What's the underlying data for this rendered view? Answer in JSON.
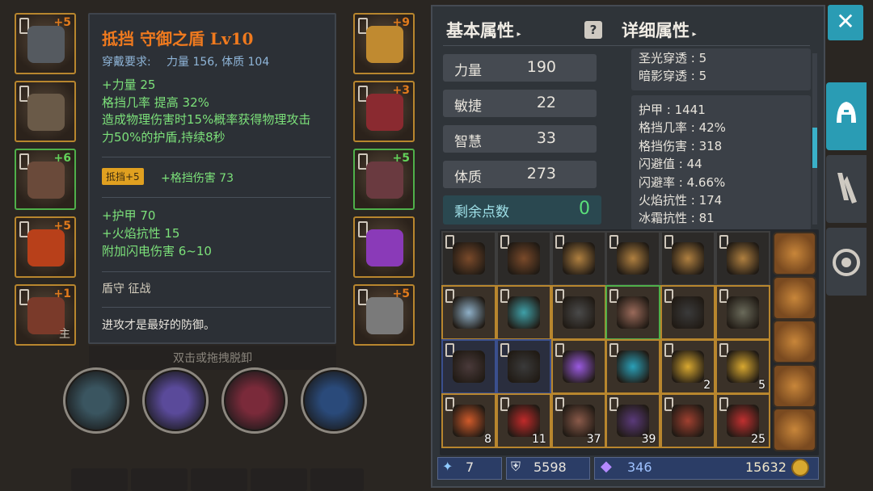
{
  "left_slots": [
    {
      "name": "helmet-slot",
      "plus": "+5",
      "green": false,
      "mark": ""
    },
    {
      "name": "chest-slot",
      "plus": "",
      "green": false,
      "mark": ""
    },
    {
      "name": "legs-slot",
      "plus": "+6",
      "green": true,
      "mark": ""
    },
    {
      "name": "ring-slot",
      "plus": "+5",
      "green": false,
      "mark": ""
    },
    {
      "name": "main-weapon-slot",
      "plus": "+1",
      "green": false,
      "mark": "主"
    }
  ],
  "right_slots": [
    {
      "name": "amulet-slot",
      "plus": "+9",
      "green": false
    },
    {
      "name": "gloves-slot",
      "plus": "+3",
      "green": false
    },
    {
      "name": "boots-slot",
      "plus": "+5",
      "green": true
    },
    {
      "name": "ring2-slot",
      "plus": "",
      "green": false
    },
    {
      "name": "shield-slot",
      "plus": "+5",
      "green": false
    }
  ],
  "tooltip": {
    "title": "抵挡 守御之盾 Lv10",
    "req_label": "穿戴要求:",
    "req_values": "力量 156, 体质 104",
    "stats1": [
      "+力量 25",
      "格挡几率 提高 32%",
      "造成物理伤害时15%概率获得物理攻击",
      "力50%的护盾,持续8秒"
    ],
    "enchant_badge": "抵挡+5",
    "enchant_text": "+格挡伤害 73",
    "stats2": [
      "+护甲 70",
      "+火焰抗性 15",
      "附加闪电伤害 6~10"
    ],
    "tags": "盾守  征战",
    "flavor": "进攻才是最好的防御。",
    "hint": "双击或拖拽脱卸"
  },
  "skills": [
    "blade-skill-icon",
    "boot-skill-icon",
    "slash-skill-icon",
    "shadow-skill-icon"
  ],
  "panel": {
    "basic_title": "基本属性",
    "detail_title": "详细属性",
    "basic_stats": [
      {
        "label": "力量",
        "value": "190"
      },
      {
        "label": "敏捷",
        "value": "22"
      },
      {
        "label": "智慧",
        "value": "33"
      },
      {
        "label": "体质",
        "value": "273"
      }
    ],
    "remaining_label": "剩余点数",
    "remaining_value": "0",
    "detail_top": [
      "圣光穿透 : 5",
      "暗影穿透 : 5"
    ],
    "detail_main": [
      "护甲 : 1441",
      "格挡几率 : 42%",
      "格挡伤害 : 318",
      "闪避值 : 44",
      "闪避率 : 4.66%",
      "火焰抗性 : 174",
      "冰霜抗性 : 81"
    ]
  },
  "inventory": [
    [
      {
        "b": "dark",
        "c": "#7a4a2a",
        "n": ""
      },
      {
        "b": "dark",
        "c": "#7a4a2a",
        "n": ""
      },
      {
        "b": "dark",
        "c": "#b08040",
        "n": ""
      },
      {
        "b": "dark",
        "c": "#b08040",
        "n": ""
      },
      {
        "b": "dark",
        "c": "#b08040",
        "n": ""
      },
      {
        "b": "dark",
        "c": "#b08040",
        "n": ""
      }
    ],
    [
      {
        "b": "gold",
        "c": "#8fb0c8",
        "n": ""
      },
      {
        "b": "gold",
        "c": "#3fa0a8",
        "n": ""
      },
      {
        "b": "gold",
        "c": "#4a4a4a",
        "n": ""
      },
      {
        "b": "green",
        "c": "#9a6a5a",
        "n": ""
      },
      {
        "b": "gold",
        "c": "#3a3a3a",
        "n": ""
      },
      {
        "b": "gold",
        "c": "#6a6a5a",
        "n": ""
      }
    ],
    [
      {
        "b": "blue",
        "c": "#4a3a3a",
        "n": ""
      },
      {
        "b": "blue",
        "c": "#3a3a3a",
        "n": ""
      },
      {
        "b": "gold",
        "c": "#9a5ae0",
        "n": ""
      },
      {
        "b": "gold",
        "c": "#2aa0b8",
        "n": ""
      },
      {
        "b": "gold",
        "c": "#d8a830",
        "n": "2"
      },
      {
        "b": "gold",
        "c": "#d8a830",
        "n": "5"
      }
    ],
    [
      {
        "b": "gold",
        "c": "#d05a2a",
        "n": "8"
      },
      {
        "b": "gold",
        "c": "#c02a2a",
        "n": "11"
      },
      {
        "b": "gold",
        "c": "#8a5a4a",
        "n": "37"
      },
      {
        "b": "gold",
        "c": "#5a3a7a",
        "n": "39"
      },
      {
        "b": "gold",
        "c": "#a04030",
        "n": ""
      },
      {
        "b": "gold",
        "c": "#c03030",
        "n": "25"
      }
    ]
  ],
  "currency": {
    "keys": "7",
    "silver": "5598",
    "crystals": "346",
    "gold": "15632"
  },
  "colors": {
    "accent": "#2a9cb4",
    "orange": "#f07a1e",
    "green_text": "#7ce17a",
    "blue_text": "#8fb5d8"
  }
}
